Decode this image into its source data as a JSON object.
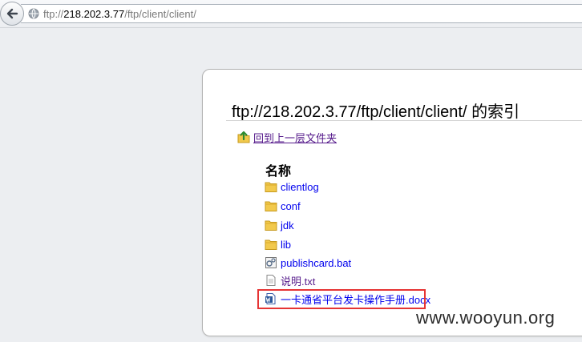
{
  "browser": {
    "url_prefix": "ftp://",
    "url_host": "218.202.3.77",
    "url_path": "/ftp/client/client/"
  },
  "listing": {
    "title": "ftp://218.202.3.77/ftp/client/client/ 的索引",
    "up_label": "回到上一层文件夹",
    "column_header": "名称",
    "entries": [
      {
        "name": "clientlog",
        "type": "folder",
        "icon": "folder-icon"
      },
      {
        "name": "conf",
        "type": "folder",
        "icon": "folder-icon"
      },
      {
        "name": "jdk",
        "type": "folder",
        "icon": "folder-icon"
      },
      {
        "name": "lib",
        "type": "folder",
        "icon": "folder-icon"
      },
      {
        "name": "publishcard.bat",
        "type": "file",
        "icon": "batch-file-icon"
      },
      {
        "name": "说明.txt",
        "type": "file",
        "icon": "text-file-icon"
      },
      {
        "name": "一卡通省平台发卡操作手册.docx",
        "type": "file",
        "icon": "word-document-icon"
      }
    ]
  },
  "watermark": "www.wooyun.org",
  "colors": {
    "link": "#0000ee",
    "visited_link": "#551a8b",
    "highlight": "#e63434",
    "folder": "#f2c94c"
  }
}
